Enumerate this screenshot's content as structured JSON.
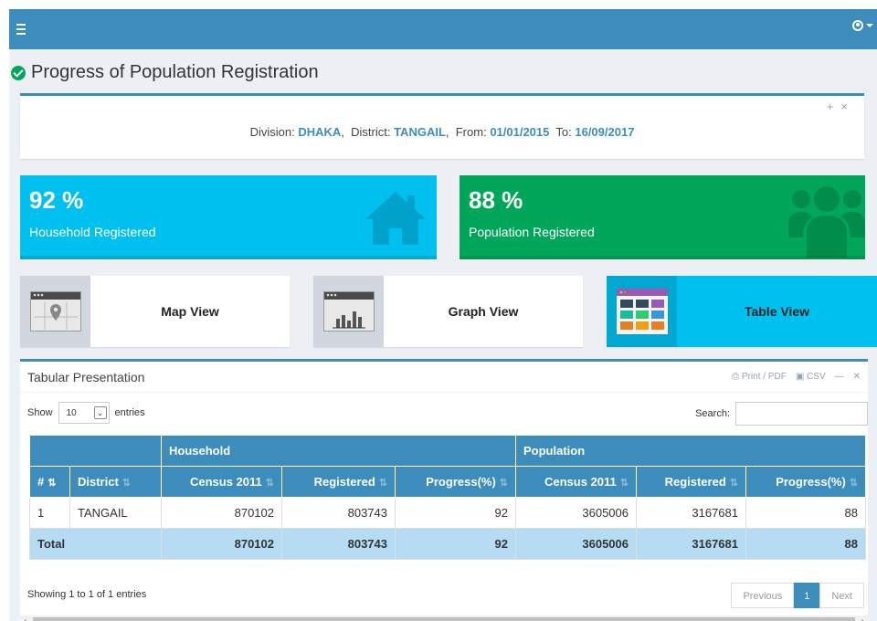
{
  "page": {
    "title": "Progress of Population Registration"
  },
  "filter": {
    "division_label": "Division:",
    "division_value": "DHAKA",
    "district_label": "District:",
    "district_value": "TANGAIL",
    "from_label": "From:",
    "from_value": "01/01/2015",
    "to_label": "To:",
    "to_value": "16/09/2017"
  },
  "stats": [
    {
      "value": "92 %",
      "label": "Household Registered",
      "color": "#00c0ef",
      "icon": "home-icon"
    },
    {
      "value": "88 %",
      "label": "Population Registered",
      "color": "#00a65a",
      "icon": "users-icon"
    }
  ],
  "views": [
    {
      "label": "Map View",
      "icon": "map-window-icon"
    },
    {
      "label": "Graph View",
      "icon": "chart-window-icon"
    },
    {
      "label": "Table View",
      "icon": "table-window-icon"
    }
  ],
  "table_box": {
    "title": "Tabular Presentation",
    "print_label": "Print / PDF",
    "csv_label": "CSV",
    "show_label": "Show",
    "page_size": "10",
    "entries_label": "entries",
    "search_label": "Search:",
    "search_value": "",
    "info": "Showing 1 to 1 of 1 entries",
    "prev_label": "Previous",
    "page_label": "1",
    "next_label": "Next"
  },
  "table": {
    "group_headers": [
      "Household",
      "Population"
    ],
    "headers": [
      "#",
      "District",
      "Census 2011",
      "Registered",
      "Progress(%)",
      "Census 2011",
      "Registered",
      "Progress(%)"
    ],
    "rows": [
      [
        "1",
        "TANGAIL",
        "870102",
        "803743",
        "92",
        "3605006",
        "3167681",
        "88"
      ]
    ],
    "total": [
      "Total",
      "870102",
      "803743",
      "92",
      "3605006",
      "3167681",
      "88"
    ]
  },
  "colors": {
    "header": "#3c8dbc",
    "aqua": "#00c0ef",
    "green": "#00a65a",
    "total_row": "#b5dcf3"
  }
}
